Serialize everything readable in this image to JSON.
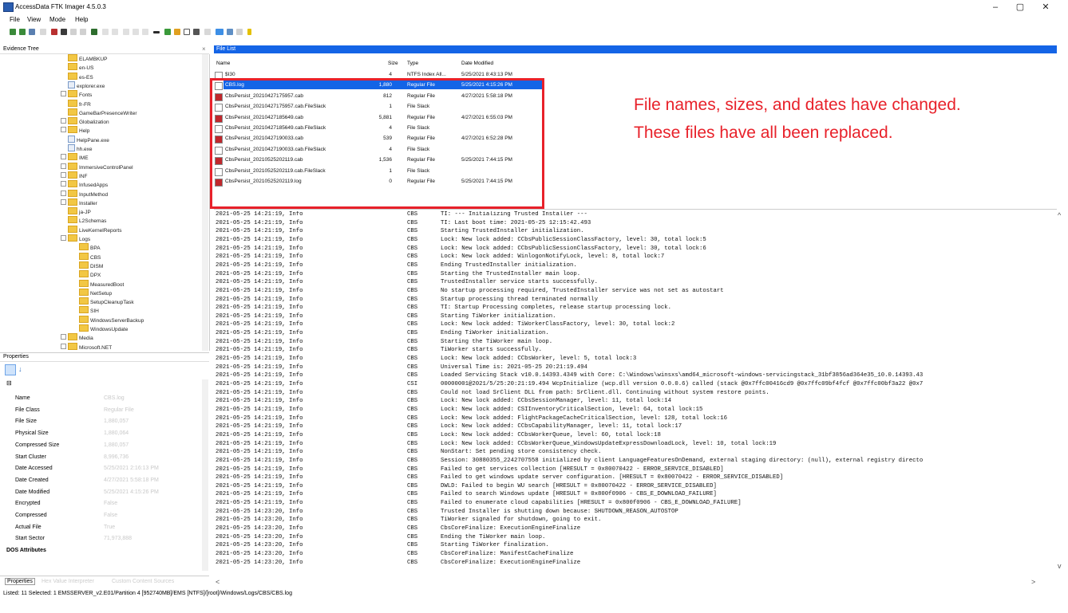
{
  "window": {
    "title": "AccessData FTK Imager 4.5.0.3",
    "minimize": "–",
    "maximize": "▢",
    "close": "✕"
  },
  "menu": [
    "File",
    "View",
    "Mode",
    "Help"
  ],
  "evidence_tree": {
    "header": "Evidence Tree",
    "close": "×",
    "items": [
      {
        "label": "ELAMBKUP",
        "indent": 2,
        "exp": false
      },
      {
        "label": "en-US",
        "indent": 2,
        "exp": false
      },
      {
        "label": "es-ES",
        "indent": 2,
        "exp": false
      },
      {
        "label": "explorer.exe",
        "indent": 2,
        "exp": false,
        "file": true
      },
      {
        "label": "Fonts",
        "indent": 2,
        "exp": true
      },
      {
        "label": "fr-FR",
        "indent": 2,
        "exp": false
      },
      {
        "label": "GameBarPresenceWriter",
        "indent": 2,
        "exp": false
      },
      {
        "label": "Globalization",
        "indent": 2,
        "exp": true
      },
      {
        "label": "Help",
        "indent": 2,
        "exp": true
      },
      {
        "label": "HelpPane.exe",
        "indent": 2,
        "exp": false,
        "file": true
      },
      {
        "label": "hh.exe",
        "indent": 2,
        "exp": false,
        "file": true
      },
      {
        "label": "IME",
        "indent": 2,
        "exp": true
      },
      {
        "label": "ImmersiveControlPanel",
        "indent": 2,
        "exp": true
      },
      {
        "label": "INF",
        "indent": 2,
        "exp": true
      },
      {
        "label": "InfusedApps",
        "indent": 2,
        "exp": true
      },
      {
        "label": "InputMethod",
        "indent": 2,
        "exp": true
      },
      {
        "label": "Installer",
        "indent": 2,
        "exp": true
      },
      {
        "label": "ja-JP",
        "indent": 2,
        "exp": false
      },
      {
        "label": "L2Schemas",
        "indent": 2,
        "exp": false
      },
      {
        "label": "LiveKernelReports",
        "indent": 2,
        "exp": false
      },
      {
        "label": "Logs",
        "indent": 2,
        "exp": true
      },
      {
        "label": "BPA",
        "indent": 3,
        "exp": false
      },
      {
        "label": "CBS",
        "indent": 3,
        "exp": false
      },
      {
        "label": "DISM",
        "indent": 3,
        "exp": false
      },
      {
        "label": "DPX",
        "indent": 3,
        "exp": false
      },
      {
        "label": "MeasuredBoot",
        "indent": 3,
        "exp": false
      },
      {
        "label": "NetSetup",
        "indent": 3,
        "exp": false
      },
      {
        "label": "SetupCleanupTask",
        "indent": 3,
        "exp": false
      },
      {
        "label": "SIH",
        "indent": 3,
        "exp": false
      },
      {
        "label": "WindowsServerBackup",
        "indent": 3,
        "exp": false
      },
      {
        "label": "WindowsUpdate",
        "indent": 3,
        "exp": false
      },
      {
        "label": "Media",
        "indent": 2,
        "exp": true
      },
      {
        "label": "Microsoft.NET",
        "indent": 2,
        "exp": true
      }
    ]
  },
  "properties": {
    "header": "Properties",
    "group": "⊟",
    "rows": [
      {
        "name": "Name",
        "value": "CBS.log"
      },
      {
        "name": "File Class",
        "value": "Regular File"
      },
      {
        "name": "File Size",
        "value": "1,880,057"
      },
      {
        "name": "Physical Size",
        "value": "1,880,064"
      },
      {
        "name": "Compressed Size",
        "value": "1,880,057"
      },
      {
        "name": "Start Cluster",
        "value": "8,996,736"
      },
      {
        "name": "Date Accessed",
        "value": "5/25/2021 2:16:13 PM"
      },
      {
        "name": "Date Created",
        "value": "4/27/2021 5:58:18 PM"
      },
      {
        "name": "Date Modified",
        "value": "5/25/2021 4:15:26 PM"
      },
      {
        "name": "Encrypted",
        "value": "False"
      },
      {
        "name": "Compressed",
        "value": "False"
      },
      {
        "name": "Actual File",
        "value": "True"
      },
      {
        "name": "Start Sector",
        "value": "71,973,888"
      }
    ],
    "dos_attributes": "DOS Attributes",
    "tabs": [
      "Properties",
      "Hex Value Interpreter",
      "Custom Content Sources"
    ]
  },
  "status_bar": "Listed: 11   Selected: 1   EMSSERVER_v2.E01/Partition 4 [952740MB]/EMS [NTFS]/[root]/Windows/Logs/CBS/CBS.log",
  "file_list": {
    "header": "File List",
    "columns": [
      "Name",
      "Size",
      "Type",
      "Date Modified"
    ],
    "rows": [
      {
        "name": "$I30",
        "size": "4",
        "type": "NTFS Index All...",
        "date": "5/25/2021 8:43:13 PM",
        "icon": "#ffffff",
        "selected": false
      },
      {
        "name": "CBS.log",
        "size": "1,880",
        "type": "Regular File",
        "date": "5/25/2021 4:15:26 PM",
        "icon": "#ffffff",
        "selected": true
      },
      {
        "name": "CbsPersist_20210427175957.cab",
        "size": "812",
        "type": "Regular File",
        "date": "4/27/2021 5:58:18 PM",
        "icon": "#c0282d",
        "selected": false
      },
      {
        "name": "CbsPersist_20210427175957.cab.FileSlack",
        "size": "1",
        "type": "File Slack",
        "date": "",
        "icon": "#ffffff",
        "selected": false
      },
      {
        "name": "CbsPersist_20210427185649.cab",
        "size": "5,881",
        "type": "Regular File",
        "date": "4/27/2021 6:55:03 PM",
        "icon": "#c0282d",
        "selected": false
      },
      {
        "name": "CbsPersist_20210427185649.cab.FileSlack",
        "size": "4",
        "type": "File Slack",
        "date": "",
        "icon": "#ffffff",
        "selected": false
      },
      {
        "name": "CbsPersist_20210427190033.cab",
        "size": "539",
        "type": "Regular File",
        "date": "4/27/2021 6:52:28 PM",
        "icon": "#c0282d",
        "selected": false
      },
      {
        "name": "CbsPersist_20210427190033.cab.FileSlack",
        "size": "4",
        "type": "File Slack",
        "date": "",
        "icon": "#ffffff",
        "selected": false
      },
      {
        "name": "CbsPersist_20210525202119.cab",
        "size": "1,536",
        "type": "Regular File",
        "date": "5/25/2021 7:44:15 PM",
        "icon": "#c0282d",
        "selected": false
      },
      {
        "name": "CbsPersist_20210525202119.cab.FileSlack",
        "size": "1",
        "type": "File Slack",
        "date": "",
        "icon": "#ffffff",
        "selected": false
      },
      {
        "name": "CbsPersist_20210525202119.log",
        "size": "0",
        "type": "Regular File",
        "date": "5/25/2021 7:44:15 PM",
        "icon": "#c0282d",
        "selected": false
      }
    ]
  },
  "annotation": "File names, sizes, and dates have changed. These files have all been replaced.",
  "log_lines": [
    [
      "2021-05-25 14:21:19, Info",
      "CBS",
      "TI: --- Initializing Trusted Installer ---"
    ],
    [
      "2021-05-25 14:21:19, Info",
      "CBS",
      "TI: Last boot time: 2021-05-25 12:15:42.493"
    ],
    [
      "2021-05-25 14:21:19, Info",
      "CBS",
      "Starting TrustedInstaller initialization."
    ],
    [
      "2021-05-25 14:21:19, Info",
      "CBS",
      "Lock: New lock added: CCbsPublicSessionClassFactory, level: 30, total lock:5"
    ],
    [
      "2021-05-25 14:21:19, Info",
      "CBS",
      "Lock: New lock added: CCbsPublicSessionClassFactory, level: 30, total lock:6"
    ],
    [
      "2021-05-25 14:21:19, Info",
      "CBS",
      "Lock: New lock added: WinlogonNotifyLock, level: 8, total lock:7"
    ],
    [
      "2021-05-25 14:21:19, Info",
      "CBS",
      "Ending TrustedInstaller initialization."
    ],
    [
      "2021-05-25 14:21:19, Info",
      "CBS",
      "Starting the TrustedInstaller main loop."
    ],
    [
      "2021-05-25 14:21:19, Info",
      "CBS",
      "TrustedInstaller service starts successfully."
    ],
    [
      "2021-05-25 14:21:19, Info",
      "CBS",
      "No startup processing required, TrustedInstaller service was not set as autostart"
    ],
    [
      "2021-05-25 14:21:19, Info",
      "CBS",
      "Startup processing thread terminated normally"
    ],
    [
      "2021-05-25 14:21:19, Info",
      "CBS",
      "TI: Startup Processing completes, release startup processing lock."
    ],
    [
      "2021-05-25 14:21:19, Info",
      "CBS",
      "Starting TiWorker initialization."
    ],
    [
      "2021-05-25 14:21:19, Info",
      "CBS",
      "Lock: New lock added: TiWorkerClassFactory, level: 30, total lock:2"
    ],
    [
      "2021-05-25 14:21:19, Info",
      "CBS",
      "Ending TiWorker initialization."
    ],
    [
      "2021-05-25 14:21:19, Info",
      "CBS",
      "Starting the TiWorker main loop."
    ],
    [
      "2021-05-25 14:21:19, Info",
      "CBS",
      "TiWorker starts successfully."
    ],
    [
      "2021-05-25 14:21:19, Info",
      "CBS",
      "Lock: New lock added: CCbsWorker, level: 5, total lock:3"
    ],
    [
      "2021-05-25 14:21:19, Info",
      "CBS",
      "Universal Time is: 2021-05-25 20:21:19.494"
    ],
    [
      "2021-05-25 14:21:19, Info",
      "CBS",
      "Loaded Servicing Stack v10.0.14393.4349 with Core: C:\\Windows\\winsxs\\amd64_microsoft-windows-servicingstack_31bf3856ad364e35_10.0.14393.43"
    ],
    [
      "2021-05-25 14:21:19, Info",
      "CSI",
      "00000001@2021/5/25:20:21:19.494 WcpInitialize (wcp.dll version 0.0.0.6) called (stack @0x7ffc00416cd9 @0x7ffc09bf4fcf @0x7ffc00bf3a22 @0x7"
    ],
    [
      "2021-05-25 14:21:19, Info",
      "CBS",
      "Could not load SrClient DLL from path: SrClient.dll.  Continuing without system restore points."
    ],
    [
      "2021-05-25 14:21:19, Info",
      "CBS",
      "Lock: New lock added: CCbsSessionManager, level: 11, total lock:14"
    ],
    [
      "2021-05-25 14:21:19, Info",
      "CBS",
      "Lock: New lock added: CSIInventoryCriticalSection, level: 64, total lock:15"
    ],
    [
      "2021-05-25 14:21:19, Info",
      "CBS",
      "Lock: New lock added: FlightPackageCacheCriticalSection, level: 128, total lock:16"
    ],
    [
      "2021-05-25 14:21:19, Info",
      "CBS",
      "Lock: New lock added: CCbsCapabilityManager, level: 11, total lock:17"
    ],
    [
      "2021-05-25 14:21:19, Info",
      "CBS",
      "Lock: New lock added: CCbsWorkerQueue, level: 60, total lock:18"
    ],
    [
      "2021-05-25 14:21:19, Info",
      "CBS",
      "Lock: New lock added: CCbsWorkerQueue_WindowsUpdateExpressDownloadLock, level: 10, total lock:19"
    ],
    [
      "2021-05-25 14:21:19, Info",
      "CBS",
      "NonStart: Set pending store consistency check."
    ],
    [
      "2021-05-25 14:21:19, Info",
      "CBS",
      "Session: 30880355_2242707558 initialized by client LanguageFeaturesOnDemand, external staging directory: (null), external registry directo"
    ],
    [
      "2021-05-25 14:21:19, Info",
      "CBS",
      "Failed to get services collection [HRESULT = 0x80070422 - ERROR_SERVICE_DISABLED]"
    ],
    [
      "2021-05-25 14:21:19, Info",
      "CBS",
      "Failed to get windows update server configuration. [HRESULT = 0x80070422 - ERROR_SERVICE_DISABLED]"
    ],
    [
      "2021-05-25 14:21:19, Info",
      "CBS",
      "DWLD: Failed to begin WU search [HRESULT = 0x80070422 - ERROR_SERVICE_DISABLED]"
    ],
    [
      "2021-05-25 14:21:19, Info",
      "CBS",
      "Failed to search Windows update [HRESULT = 0x800f0906 - CBS_E_DOWNLOAD_FAILURE]"
    ],
    [
      "2021-05-25 14:21:19, Info",
      "CBS",
      "Failed to enumerate cloud capabilities [HRESULT = 0x800f0906 - CBS_E_DOWNLOAD_FAILURE]"
    ],
    [
      "2021-05-25 14:23:20, Info",
      "CBS",
      "Trusted Installer is shutting down because: SHUTDOWN_REASON_AUTOSTOP"
    ],
    [
      "2021-05-25 14:23:20, Info",
      "CBS",
      "TiWorker signaled for shutdown, going to exit."
    ],
    [
      "2021-05-25 14:23:20, Info",
      "CBS",
      "CbsCoreFinalize: ExecutionEngineFinalize"
    ],
    [
      "2021-05-25 14:23:20, Info",
      "CBS",
      "Ending the TiWorker main loop."
    ],
    [
      "2021-05-25 14:23:20, Info",
      "CBS",
      "Starting TiWorker finalization."
    ],
    [
      "2021-05-25 14:23:20, Info",
      "CBS",
      "CbsCoreFinalize: ManifestCacheFinalize"
    ],
    [
      "2021-05-25 14:23:20, Info",
      "CBS",
      "CbsCoreFinalize: ExecutionEngineFinalize"
    ]
  ]
}
